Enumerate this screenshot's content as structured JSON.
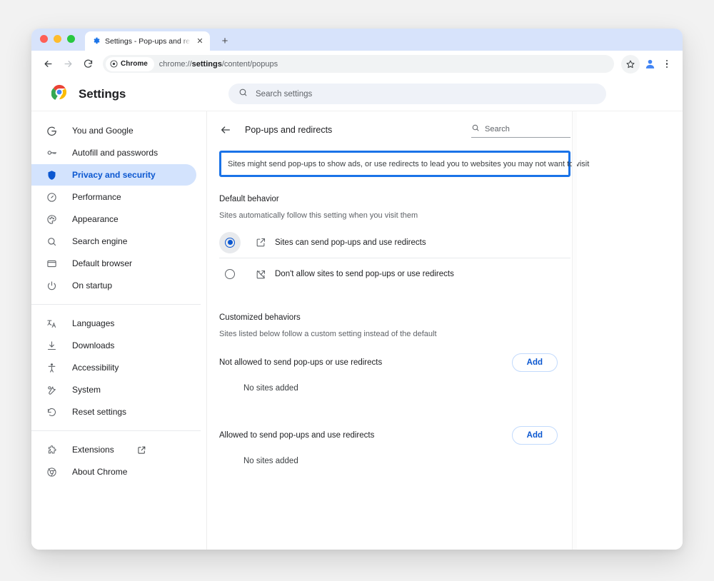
{
  "browser": {
    "tab": {
      "title": "Settings - Pop-ups and redir",
      "favicon_name": "settings-gear-icon",
      "close_label": "✕"
    },
    "new_tab_label": "+",
    "toolbar": {
      "back_label": "←",
      "forward_label": "→",
      "reload_label": "⟳",
      "chrome_chip_label": "Chrome",
      "url_prefix": "chrome://",
      "url_bold": "settings",
      "url_suffix": "/content/popups",
      "full_url": "chrome://settings/content/popups"
    }
  },
  "settings_header": {
    "title": "Settings",
    "search_placeholder": "Search settings"
  },
  "sidebar": {
    "groups": [
      {
        "items": [
          {
            "label": "You and Google",
            "icon": "google-g-icon",
            "active": false
          },
          {
            "label": "Autofill and passwords",
            "icon": "key-icon",
            "active": false
          },
          {
            "label": "Privacy and security",
            "icon": "shield-icon",
            "active": true
          },
          {
            "label": "Performance",
            "icon": "speedometer-icon",
            "active": false
          },
          {
            "label": "Appearance",
            "icon": "palette-icon",
            "active": false
          },
          {
            "label": "Search engine",
            "icon": "search-icon",
            "active": false
          },
          {
            "label": "Default browser",
            "icon": "window-icon",
            "active": false
          },
          {
            "label": "On startup",
            "icon": "power-icon",
            "active": false
          }
        ]
      },
      {
        "items": [
          {
            "label": "Languages",
            "icon": "translate-icon",
            "active": false
          },
          {
            "label": "Downloads",
            "icon": "download-icon",
            "active": false
          },
          {
            "label": "Accessibility",
            "icon": "accessibility-icon",
            "active": false
          },
          {
            "label": "System",
            "icon": "wrench-icon",
            "active": false
          },
          {
            "label": "Reset settings",
            "icon": "reset-icon",
            "active": false
          }
        ]
      },
      {
        "items": [
          {
            "label": "Extensions",
            "icon": "puzzle-icon",
            "active": false,
            "external": true
          },
          {
            "label": "About Chrome",
            "icon": "chrome-icon",
            "active": false
          }
        ]
      }
    ]
  },
  "content": {
    "back_label": "←",
    "page_title": "Pop-ups and redirects",
    "inner_search_placeholder": "Search",
    "info_banner": {
      "text": "Sites might send pop-ups to show ads, or use redirects to lead you to websites you may not want to visit",
      "highlight_color": "#1a73e8"
    },
    "default_behavior": {
      "title": "Default behavior",
      "subtitle": "Sites automatically follow this setting when you visit them",
      "options": [
        {
          "label": "Sites can send pop-ups and use redirects",
          "icon": "open-in-new-icon",
          "selected": true
        },
        {
          "label": "Don't allow sites to send pop-ups or use redirects",
          "icon": "open-in-new-off-icon",
          "selected": false
        }
      ]
    },
    "customized_behaviors": {
      "title": "Customized behaviors",
      "subtitle": "Sites listed below follow a custom setting instead of the default",
      "lists": [
        {
          "label": "Not allowed to send pop-ups or use redirects",
          "add_label": "Add",
          "empty_text": "No sites added"
        },
        {
          "label": "Allowed to send pop-ups and use redirects",
          "add_label": "Add",
          "empty_text": "No sites added"
        }
      ]
    }
  }
}
